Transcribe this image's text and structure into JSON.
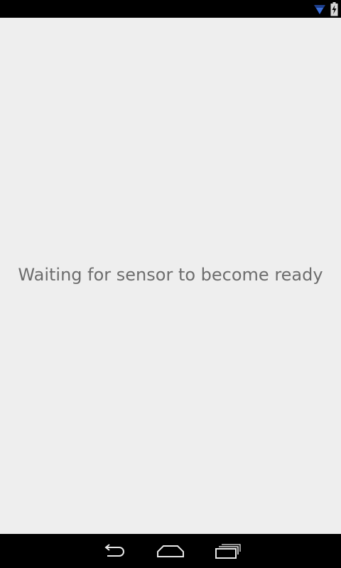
{
  "status_bar": {
    "icons": [
      "wifi-icon",
      "battery-charging-icon"
    ],
    "wifi_color": "#3b6fd8"
  },
  "main": {
    "message": "Waiting for sensor to become ready"
  },
  "nav_bar": {
    "buttons": [
      "back-icon",
      "home-icon",
      "recents-icon"
    ]
  },
  "colors": {
    "background": "#eeeeee",
    "text": "#6d6d6d",
    "bars": "#000000"
  }
}
